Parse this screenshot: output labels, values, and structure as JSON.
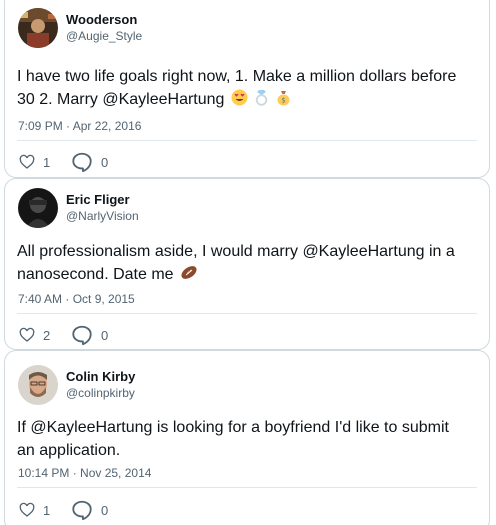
{
  "tweets": [
    {
      "author_name": "Wooderson",
      "author_handle": "@Augie_Style",
      "text": "I have two life goals right now, 1. Make a million dollars before 30 2. Marry @KayleeHartung",
      "emojis": [
        "heart-eyes-emoji",
        "ring-emoji",
        "money-bag-emoji"
      ],
      "timestamp": "7:09 PM · Apr 22, 2016",
      "likes": "1",
      "replies": "0"
    },
    {
      "author_name": "Eric Fliger",
      "author_handle": "@NarlyVision",
      "text": "All professionalism aside, I would marry @KayleeHartung in a nanosecond. Date me",
      "emojis": [
        "football-emoji"
      ],
      "timestamp": "7:40 AM · Oct 9, 2015",
      "likes": "2",
      "replies": "0"
    },
    {
      "author_name": "Colin Kirby",
      "author_handle": "@colinpkirby",
      "text": "If @KayleeHartung is looking for a boyfriend I'd like to submit an application.",
      "emojis": [],
      "timestamp": "10:14 PM · Nov 25, 2014",
      "likes": "1",
      "replies": "0"
    }
  ],
  "colors": {
    "text": "#0f1419",
    "secondary": "#536471",
    "border": "#cfd9de"
  }
}
